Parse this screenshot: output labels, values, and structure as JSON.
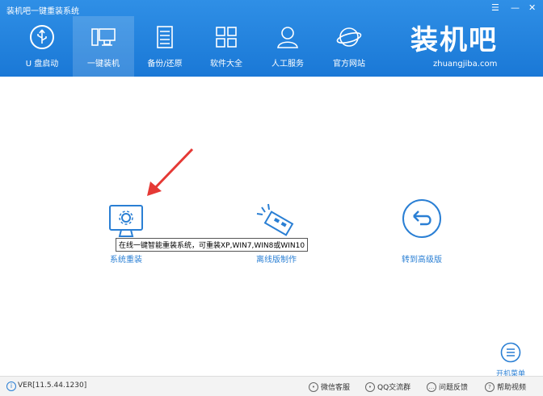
{
  "window": {
    "title": "装机吧一键重装系统",
    "menu_glyph": "☰",
    "minimize_glyph": "—",
    "close_glyph": "✕"
  },
  "nav": {
    "items": [
      {
        "label": "U 盘启动",
        "icon": "usb-icon"
      },
      {
        "label": "一键装机",
        "icon": "computer-icon",
        "active": true
      },
      {
        "label": "备份/还原",
        "icon": "backup-icon"
      },
      {
        "label": "软件大全",
        "icon": "apps-icon"
      },
      {
        "label": "人工服务",
        "icon": "user-service-icon"
      },
      {
        "label": "官方网站",
        "icon": "website-icon"
      }
    ]
  },
  "brand": {
    "logo_text": "装机吧",
    "url": "zhuangjiba.com"
  },
  "main": {
    "features": [
      {
        "label": "系统重装",
        "icon": "monitor-gear-icon"
      },
      {
        "label": "离线版制作",
        "icon": "usb-drive-icon"
      },
      {
        "label": "转到高级版",
        "icon": "back-arrow-icon"
      }
    ],
    "tooltip": "在线一键智能重装系统，可重装XP,WIN7,WIN8或WIN10",
    "boot_menu_label": "开机菜单"
  },
  "footer": {
    "version": "VER[11.5.44.1230]",
    "links": [
      {
        "label": "微信客服",
        "icon": "wechat-icon"
      },
      {
        "label": "QQ交流群",
        "icon": "qq-icon"
      },
      {
        "label": "问题反馈",
        "icon": "feedback-icon"
      },
      {
        "label": "帮助视频",
        "icon": "help-icon"
      }
    ]
  },
  "colors": {
    "header": "#1a78d6",
    "accent": "#2a7fd4",
    "arrow": "#e53935"
  }
}
